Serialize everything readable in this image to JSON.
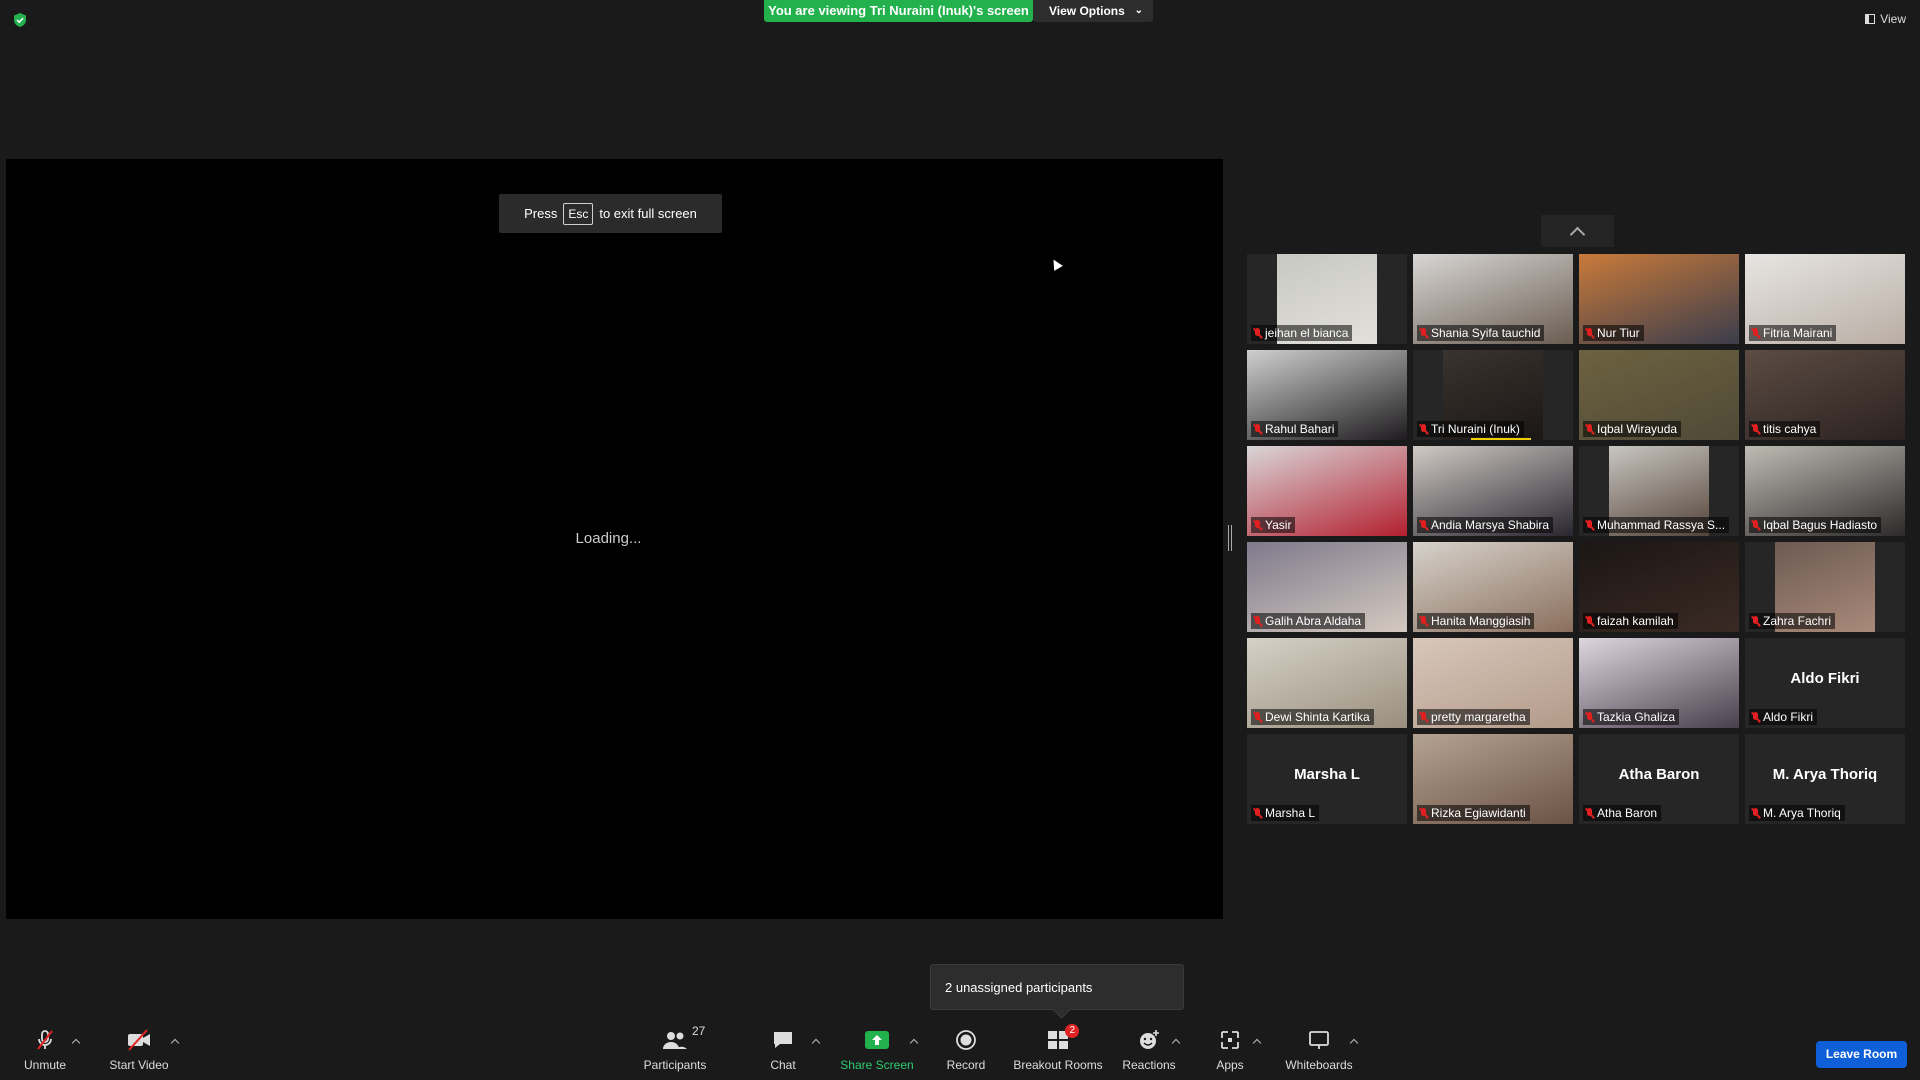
{
  "top": {
    "banner": "You are viewing Tri Nuraini (Inuk)'s screen",
    "view_options": "View Options",
    "view_button": "View"
  },
  "share": {
    "esc_before": "Press",
    "esc_key": "Esc",
    "esc_after": "to exit full screen",
    "loading": "Loading..."
  },
  "participants": [
    {
      "name": "jeihan el bianca",
      "video": true,
      "colors": [
        "#c8c8c2",
        "#e2e0da"
      ]
    },
    {
      "name": "Shania Syifa tauchid",
      "video": true,
      "colors": [
        "#d8d6d4",
        "#6a5d52"
      ]
    },
    {
      "name": "Nur Tiur",
      "video": true,
      "colors": [
        "#c97a3a",
        "#3b3d4c"
      ]
    },
    {
      "name": "Fitria Mairani",
      "video": true,
      "colors": [
        "#e7e5e2",
        "#b9aea5"
      ]
    },
    {
      "name": "Rahul Bahari",
      "video": true,
      "colors": [
        "#d0cfd0",
        "#1e1c1e"
      ]
    },
    {
      "name": "Tri Nuraini (Inuk)",
      "video": true,
      "colors": [
        "#3a332f",
        "#1b1715"
      ],
      "speaking": true
    },
    {
      "name": "Iqbal Wirayuda",
      "video": true,
      "colors": [
        "#6d6240",
        "#4f4a37"
      ]
    },
    {
      "name": "titis cahya",
      "video": true,
      "colors": [
        "#5c4c43",
        "#2b2220"
      ]
    },
    {
      "name": "Yasir",
      "video": true,
      "colors": [
        "#d9d6d8",
        "#b32030"
      ]
    },
    {
      "name": "Andia Marsya Shabira",
      "video": true,
      "colors": [
        "#cfcac4",
        "#2a2630"
      ]
    },
    {
      "name": "Muhammad Rassya S...",
      "video": true,
      "colors": [
        "#c9c6c1",
        "#54443a"
      ]
    },
    {
      "name": "Iqbal Bagus Hadiasto",
      "video": true,
      "colors": [
        "#bfbcb4",
        "#2c2a2a"
      ]
    },
    {
      "name": "Galih Abra Aldaha",
      "video": true,
      "colors": [
        "#7f7a8c",
        "#d4c9c0"
      ]
    },
    {
      "name": "Hanita Manggiasih",
      "video": true,
      "colors": [
        "#d6d2cb",
        "#8b6f5d"
      ]
    },
    {
      "name": "faizah kamilah",
      "video": true,
      "colors": [
        "#1c1614",
        "#3a2a24"
      ]
    },
    {
      "name": "Zahra Fachri",
      "video": true,
      "colors": [
        "#6d5a52",
        "#a98a7a"
      ]
    },
    {
      "name": "Dewi Shinta Kartika",
      "video": true,
      "colors": [
        "#d5d1c6",
        "#9a8f7e"
      ]
    },
    {
      "name": "pretty margaretha",
      "video": true,
      "colors": [
        "#d8c7bb",
        "#b39a89"
      ]
    },
    {
      "name": "Tazkia Ghaliza",
      "video": true,
      "colors": [
        "#ddd6df",
        "#4a3f4c"
      ]
    },
    {
      "name": "Aldo Fikri",
      "video": false,
      "big_name": "Aldo Fikri"
    },
    {
      "name": "Marsha L",
      "video": false,
      "big_name": "Marsha L"
    },
    {
      "name": "Rizka Egiawidanti",
      "video": true,
      "colors": [
        "#b5a391",
        "#6b5245"
      ]
    },
    {
      "name": "Atha Baron",
      "video": false,
      "big_name": "Atha Baron"
    },
    {
      "name": "M. Arya Thoriq",
      "video": false,
      "big_name": "M. Arya Thoriq"
    }
  ],
  "popover": "2 unassigned participants",
  "toolbar": {
    "unmute": "Unmute",
    "start_video": "Start Video",
    "participants": "Participants",
    "participants_count": "27",
    "chat": "Chat",
    "share_screen": "Share Screen",
    "record": "Record",
    "breakout_rooms": "Breakout Rooms",
    "breakout_badge": "2",
    "reactions": "Reactions",
    "apps": "Apps",
    "whiteboards": "Whiteboards",
    "leave": "Leave Room"
  }
}
